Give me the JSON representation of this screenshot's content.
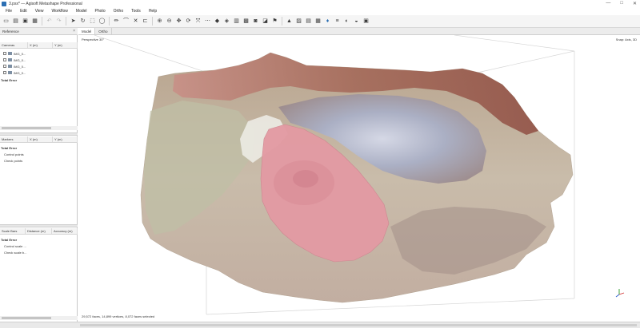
{
  "window": {
    "title": "3.psx* — Agisoft Metashape Professional",
    "controls": [
      "—",
      "□",
      "✕"
    ]
  },
  "menu": [
    "File",
    "Edit",
    "View",
    "Workflow",
    "Model",
    "Photo",
    "Ortho",
    "Tools",
    "Help"
  ],
  "reference_panel": {
    "title": "Reference",
    "cameras_table": {
      "columns": [
        "Cameras",
        "X (m)",
        "Y (m)"
      ],
      "rows": [
        "IMG_0...",
        "IMG_0...",
        "IMG_0...",
        "IMG_0..."
      ],
      "total_label": "Total Error"
    },
    "markers_table": {
      "columns": [
        "Markers",
        "X (m)",
        "Y (m)"
      ],
      "total_label": "Total Error",
      "items": [
        "Control points",
        "Check points"
      ]
    },
    "scalebars_table": {
      "columns": [
        "Scale Bars",
        "Distance (m)",
        "Accuracy (m)"
      ],
      "total_label": "Total Error",
      "items": [
        "Control scale ...",
        "Check scale b..."
      ]
    }
  },
  "tabs": [
    "Model",
    "Ortho"
  ],
  "viewport": {
    "perspective_label": "Perspective 30°",
    "snap_label": "Snap: Axis, 3D",
    "stats_label": "29,572 faces, 14,899 vertices, 8,072 faces selected",
    "colors": {
      "terrain": "#c4b6a3",
      "selection": "#e39aa3",
      "blue_area": "#a8afc8",
      "rim": "#9c5c50"
    }
  }
}
